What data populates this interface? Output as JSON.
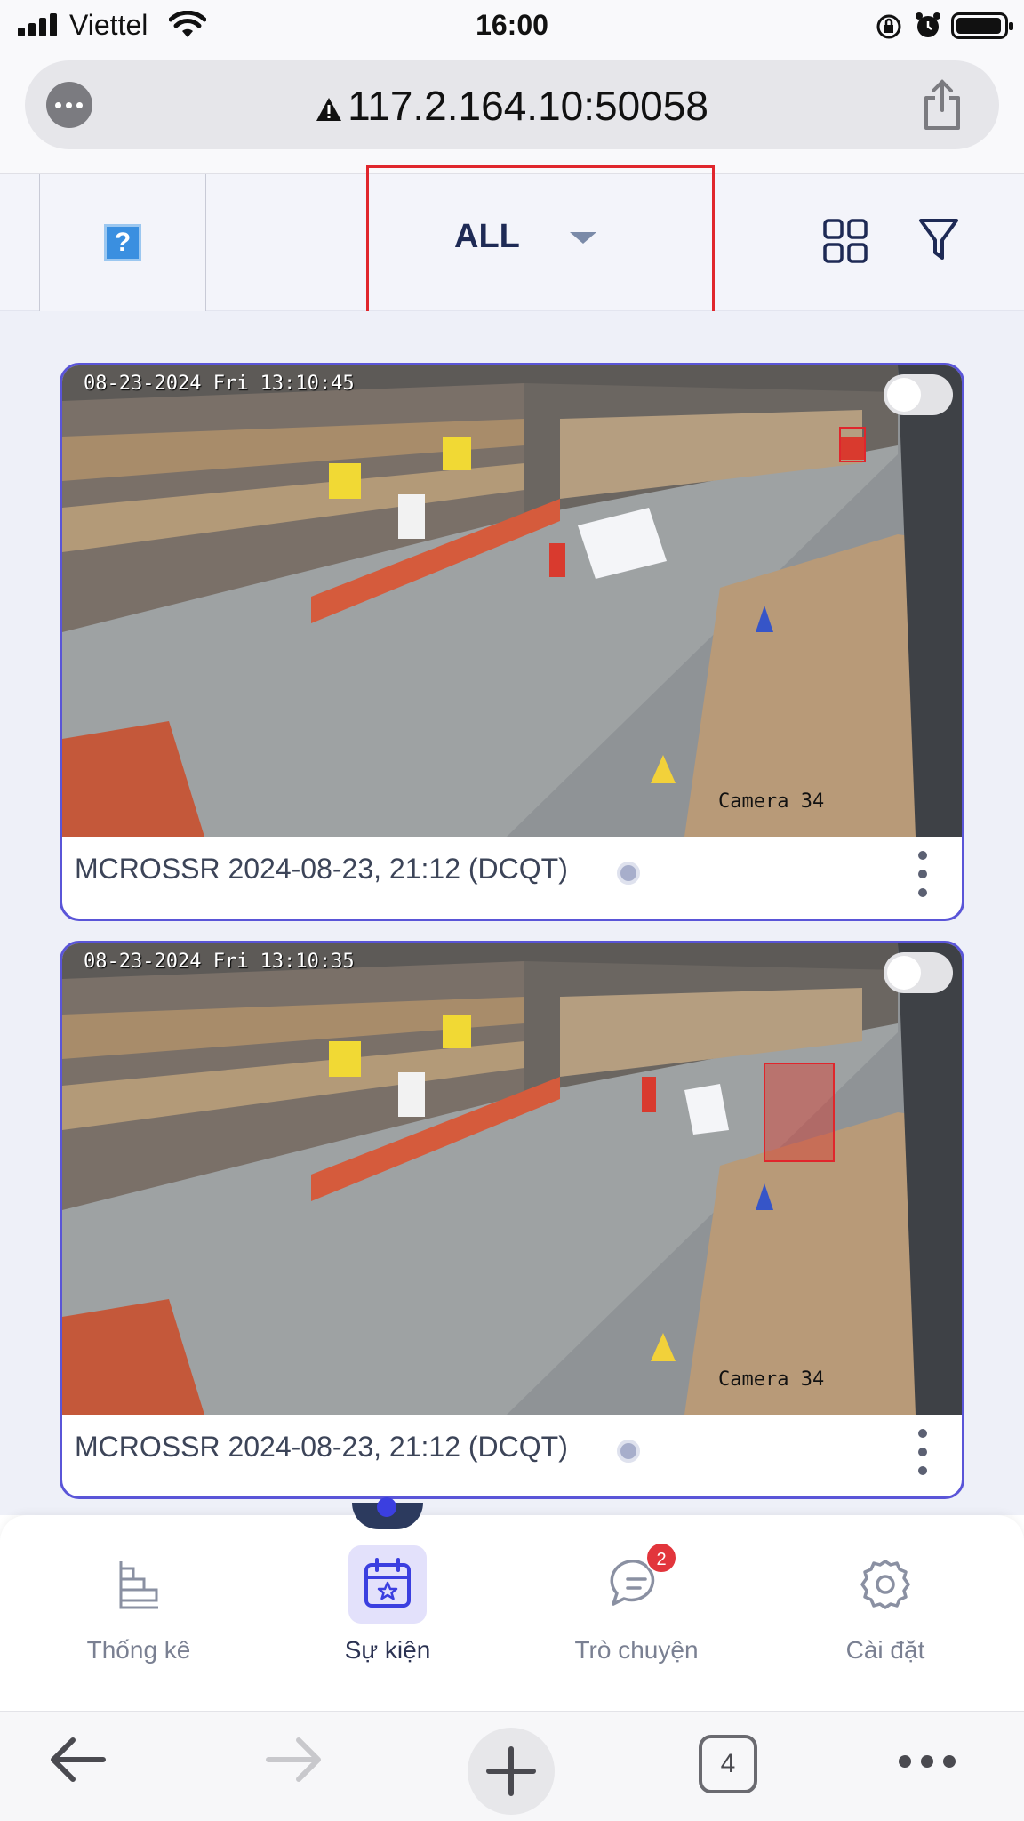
{
  "status_bar": {
    "carrier": "Viettel",
    "time": "16:00"
  },
  "browser": {
    "url": "117.2.164.10:50058"
  },
  "header": {
    "filter_label": "ALL",
    "help_glyph": "?"
  },
  "cards": [
    {
      "overlay_time": "08-23-2024 Fri 13:10:45",
      "camera_label": "Camera 34",
      "caption": "MCROSSR 2024-08-23, 21:12 (DCQT)"
    },
    {
      "overlay_time": "08-23-2024 Fri 13:10:35",
      "camera_label": "Camera 34",
      "caption": "MCROSSR 2024-08-23, 21:12 (DCQT)"
    }
  ],
  "nav": {
    "items": [
      {
        "label": "Thống kê",
        "icon": "chart-icon"
      },
      {
        "label": "Sự kiện",
        "icon": "calendar-star-icon"
      },
      {
        "label": "Trò chuyện",
        "icon": "chat-icon",
        "badge": "2"
      },
      {
        "label": "Cài đặt",
        "icon": "gear-icon"
      }
    ]
  },
  "safari": {
    "tab_count": "4"
  },
  "colors": {
    "accent": "#5a55d8",
    "highlight_box": "#e0262c",
    "badge": "#e2353c"
  }
}
